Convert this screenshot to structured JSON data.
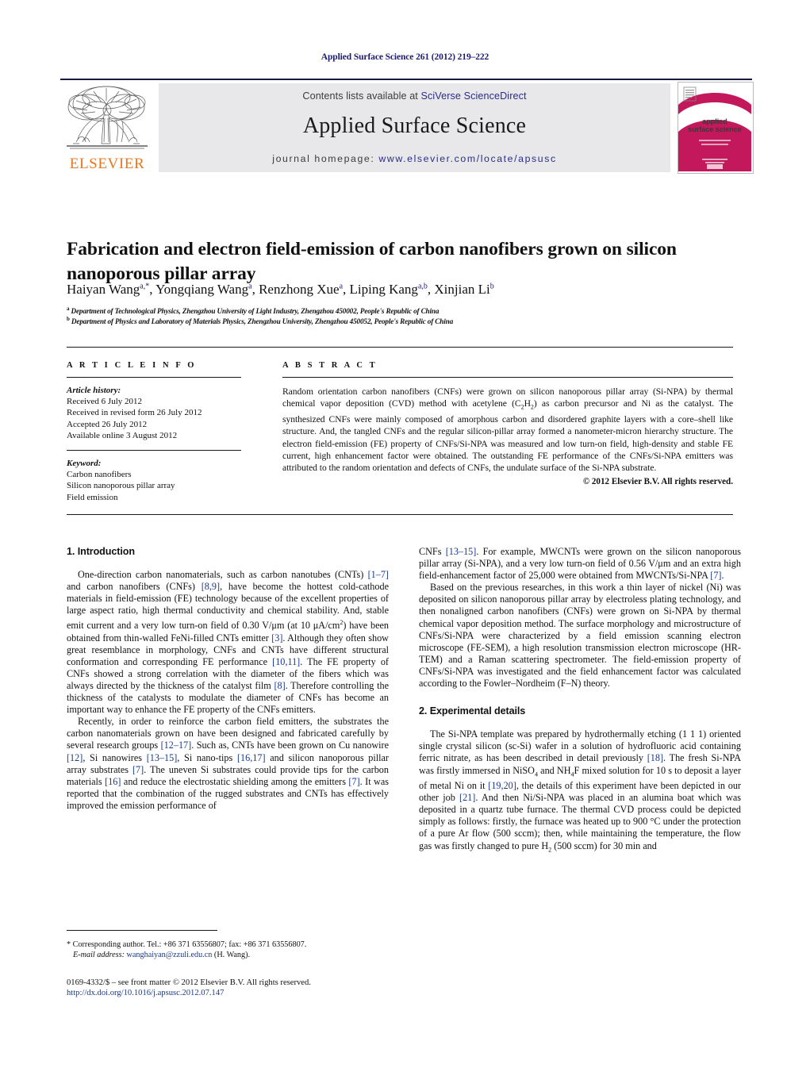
{
  "running_head": "Applied Surface Science 261 (2012) 219–222",
  "masthead": {
    "contents_prefix": "Contents lists available at ",
    "contents_link": "SciVerse ScienceDirect",
    "journal_title": "Applied Surface Science",
    "homepage_prefix": "journal homepage: ",
    "homepage_link": "www.elsevier.com/locate/apsusc",
    "publisher_name": "ELSEVIER",
    "cover_line1": "applied",
    "cover_line2": "surface science",
    "colors": {
      "link": "#2b2b8c",
      "band": "#e8e8ea",
      "elsevier_orange": "#E87722",
      "cover_magenta": "#C3185B",
      "running_head": "#1b1b6f"
    }
  },
  "article": {
    "title": "Fabrication and electron field-emission of carbon nanofibers grown on silicon nanoporous pillar array",
    "authors_html": "Haiyan Wang<sup>a,*</sup>, Yongqiang Wang<sup>a</sup>, Renzhong Xue<sup>a</sup>, Liping Kang<sup>a,b</sup>, Xinjian Li<sup>b</sup>",
    "affiliation_a": "Department of Technological Physics, Zhengzhou University of Light Industry, Zhengzhou 450002, People's Republic of China",
    "affiliation_b": "Department of Physics and Laboratory of Materials Physics, Zhengzhou University, Zhengzhou 450052, People's Republic of China"
  },
  "info": {
    "heading": "A R T I C L E    I N F O",
    "history_label": "Article history:",
    "history": [
      "Received 6 July 2012",
      "Received in revised form 26 July 2012",
      "Accepted 26 July 2012",
      "Available online 3 August 2012"
    ],
    "keyword_label": "Keyword:",
    "keywords": [
      "Carbon nanofibers",
      "Silicon nanoporous pillar array",
      "Field emission"
    ]
  },
  "abstract": {
    "heading": "A B S T R A C T",
    "text": "Random orientation carbon nanofibers (CNFs) were grown on silicon nanoporous pillar array (Si-NPA) by thermal chemical vapor deposition (CVD) method with acetylene (C2H2) as carbon precursor and Ni as the catalyst. The synthesized CNFs were mainly composed of amorphous carbon and disordered graphite layers with a core–shell like structure. And, the tangled CNFs and the regular silicon-pillar array formed a nanometer-micron hierarchy structure. The electron field-emission (FE) property of CNFs/Si-NPA was measured and low turn-on field, high-density and stable FE current, high enhancement factor were obtained. The outstanding FE performance of the CNFs/Si-NPA emitters was attributed to the random orientation and defects of CNFs, the undulate surface of the Si-NPA substrate.",
    "copyright": "© 2012 Elsevier B.V. All rights reserved."
  },
  "sections": {
    "intro_heading": "1.  Introduction",
    "experimental_heading": "2.  Experimental details",
    "intro_p1": "One-direction carbon nanomaterials, such as carbon nanotubes (CNTs) [1–7] and carbon nanofibers (CNFs) [8,9], have become the hottest cold-cathode materials in field-emission (FE) technology because of the excellent properties of large aspect ratio, high thermal conductivity and chemical stability. And, stable emit current and a very low turn-on field of 0.30 V/μm (at 10 μA/cm2) have been obtained from thin-walled FeNi-filled CNTs emitter [3]. Although they often show great resemblance in morphology, CNFs and CNTs have different structural conformation and corresponding FE performance [10,11]. The FE property of CNFs showed a strong correlation with the diameter of the fibers which was always directed by the thickness of the catalyst film [8]. Therefore controlling the thickness of the catalysts to modulate the diameter of CNFs has become an important way to enhance the FE property of the CNFs emitters.",
    "intro_p2": "Recently, in order to reinforce the carbon field emitters, the substrates the carbon nanomaterials grown on have been designed and fabricated carefully by several research groups [12–17]. Such as, CNTs have been grown on Cu nanowire [12], Si nanowires [13–15], Si nano-tips [16,17] and silicon nanoporous pillar array substrates [7]. The uneven Si substrates could provide tips for the carbon materials [16] and reduce the electrostatic shielding among the emitters [7]. It was reported that the combination of the rugged substrates and CNTs has effectively improved the emission performance of CNFs [13–15]. For example, MWCNTs were grown on the silicon nanoporous pillar array (Si-NPA), and a very low turn-on field of 0.56 V/μm and an extra high field-enhancement factor of 25,000 were obtained from MWCNTs/Si-NPA [7].",
    "intro_p3": "Based on the previous researches, in this work a thin layer of nickel (Ni) was deposited on silicon nanoporous pillar array by electroless plating technology, and then nonaligned carbon nanofibers (CNFs) were grown on Si-NPA by thermal chemical vapor deposition method. The surface morphology and microstructure of CNFs/Si-NPA were characterized by a field emission scanning electron microscope (FE-SEM), a high resolution transmission electron microscope (HR-TEM) and a Raman scattering spectrometer. The field-emission property of CNFs/Si-NPA was investigated and the field enhancement factor was calculated according to the Fowler–Nordheim (F–N) theory.",
    "exp_p1": "The Si-NPA template was prepared by hydrothermally etching (1 1 1) oriented single crystal silicon (sc-Si) wafer in a solution of hydrofluoric acid containing ferric nitrate, as has been described in detail previously [18]. The fresh Si-NPA was firstly immersed in NiSO4 and NH4F mixed solution for 10 s to deposit a layer of metal Ni on it [19,20], the details of this experiment have been depicted in our other job [21]. And then Ni/Si-NPA was placed in an alumina boat which was deposited in a quartz tube furnace. The thermal CVD process could be depicted simply as follows: firstly, the furnace was heated up to 900 °C under the protection of a pure Ar flow (500 sccm); then, while maintaining the temperature, the flow gas was firstly changed to pure H2 (500 sccm) for 30 min and"
  },
  "footer": {
    "corresponding": "* Corresponding author. Tel.: +86 371 63556807; fax: +86 371 63556807.",
    "email_label": "E-mail address:",
    "email": "wanghaiyan@zzuli.edu.cn",
    "email_suffix": "(H. Wang).",
    "issn_line": "0169-4332/$ – see front matter © 2012 Elsevier B.V. All rights reserved.",
    "doi": "http://dx.doi.org/10.1016/j.apsusc.2012.07.147"
  }
}
